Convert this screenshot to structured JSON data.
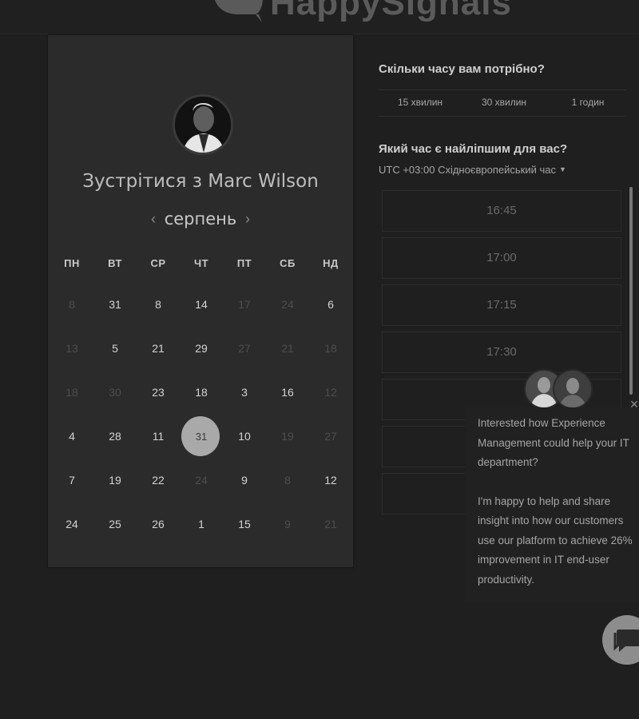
{
  "header": {
    "brand": "HappySignals"
  },
  "host": {
    "meet_title": "Зустрітися з Marc Wilson"
  },
  "calendar": {
    "month": "серпень",
    "prev_icon": "chevron-left-icon",
    "next_icon": "chevron-right-icon",
    "weekdays": [
      "ПН",
      "ВТ",
      "СР",
      "ЧТ",
      "ПТ",
      "СБ",
      "НД"
    ],
    "weeks": [
      [
        {
          "d": "8",
          "m": true
        },
        {
          "d": "31",
          "m": false
        },
        {
          "d": "8",
          "m": false
        },
        {
          "d": "14",
          "m": false
        },
        {
          "d": "17",
          "m": true
        },
        {
          "d": "24",
          "m": true
        },
        {
          "d": "6",
          "m": false
        }
      ],
      [
        {
          "d": "13",
          "m": true
        },
        {
          "d": "5",
          "m": false
        },
        {
          "d": "21",
          "m": false
        },
        {
          "d": "29",
          "m": false
        },
        {
          "d": "27",
          "m": true
        },
        {
          "d": "21",
          "m": true
        },
        {
          "d": "18",
          "m": true
        }
      ],
      [
        {
          "d": "18",
          "m": true
        },
        {
          "d": "30",
          "m": true
        },
        {
          "d": "23",
          "m": false
        },
        {
          "d": "18",
          "m": false
        },
        {
          "d": "3",
          "m": false
        },
        {
          "d": "16",
          "m": false
        },
        {
          "d": "12",
          "m": true
        }
      ],
      [
        {
          "d": "4",
          "m": false
        },
        {
          "d": "28",
          "m": false
        },
        {
          "d": "11",
          "m": false
        },
        {
          "d": "31",
          "m": false,
          "selected": true
        },
        {
          "d": "10",
          "m": false
        },
        {
          "d": "19",
          "m": true
        },
        {
          "d": "27",
          "m": true
        }
      ],
      [
        {
          "d": "7",
          "m": false
        },
        {
          "d": "19",
          "m": false
        },
        {
          "d": "22",
          "m": false
        },
        {
          "d": "24",
          "m": true
        },
        {
          "d": "9",
          "m": false
        },
        {
          "d": "8",
          "m": true
        },
        {
          "d": "12",
          "m": false
        }
      ],
      [
        {
          "d": "24",
          "m": false
        },
        {
          "d": "25",
          "m": false
        },
        {
          "d": "26",
          "m": false
        },
        {
          "d": "1",
          "m": false
        },
        {
          "d": "15",
          "m": false
        },
        {
          "d": "9",
          "m": true
        },
        {
          "d": "21",
          "m": true
        }
      ]
    ]
  },
  "duration": {
    "question": "Скільки часу вам потрібно?",
    "options": [
      "15 хвилин",
      "30 хвилин",
      "1 годин"
    ]
  },
  "timing": {
    "question": "Який час є найліпшим для вас?",
    "timezone": "UTC +03:00 Східноєвропейський час",
    "slots": [
      "16:45",
      "17:00",
      "17:15",
      "17:30",
      "",
      "",
      ""
    ]
  },
  "chat": {
    "message_1": "Interested how Experience Management could help your IT department?",
    "message_2": "I'm happy to help and share insight into how our customers use our platform to achieve 26% improvement in IT end-user productivity.",
    "close_icon": "close-icon",
    "launcher_icon": "chat-bubble-icon"
  }
}
